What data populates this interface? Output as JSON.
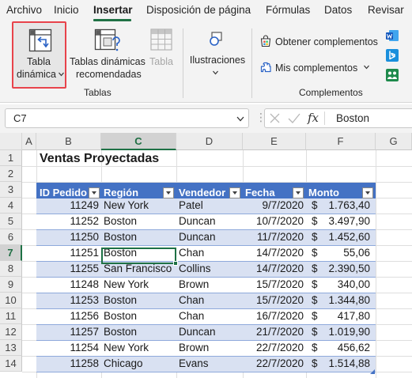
{
  "menu": {
    "tabs": [
      "Archivo",
      "Inicio",
      "Insertar",
      "Disposición de página",
      "Fórmulas",
      "Datos",
      "Revisar"
    ],
    "active": "Insertar"
  },
  "ribbon": {
    "tablas": {
      "pivot_line1": "Tabla",
      "pivot_line2": "dinámica",
      "recommended_line1": "Tablas dinámicas",
      "recommended_line2": "recomendadas",
      "table_label": "Tabla",
      "group_label": "Tablas"
    },
    "ilustraciones": {
      "label": "Ilustraciones"
    },
    "complementos": {
      "get_addins": "Obtener complementos",
      "my_addins": "Mis complementos",
      "group_label": "Complementos"
    }
  },
  "formula_bar": {
    "name_box": "C7",
    "fx_label": "fx",
    "formula": "Boston"
  },
  "grid": {
    "columns": [
      "A",
      "B",
      "C",
      "D",
      "E",
      "F",
      "G"
    ],
    "selected_column": "C",
    "rows": [
      "1",
      "2",
      "3",
      "4",
      "5",
      "6",
      "7",
      "8",
      "9",
      "10",
      "11",
      "12",
      "13",
      "14"
    ],
    "selected_row": "7"
  },
  "sheet": {
    "title": "Ventas Proyectadas",
    "headers": [
      "ID Pedido",
      "Región",
      "Vendedor",
      "Fecha",
      "Monto"
    ],
    "currency_symbol": "$",
    "rows": [
      {
        "id": "11249",
        "region": "New York",
        "seller": "Patel",
        "date": "9/7/2020",
        "amount": "1.763,40"
      },
      {
        "id": "11252",
        "region": "Boston",
        "seller": "Duncan",
        "date": "10/7/2020",
        "amount": "3.497,90"
      },
      {
        "id": "11250",
        "region": "Boston",
        "seller": "Duncan",
        "date": "11/7/2020",
        "amount": "1.452,60"
      },
      {
        "id": "11251",
        "region": "Boston",
        "seller": "Chan",
        "date": "14/7/2020",
        "amount": "55,06"
      },
      {
        "id": "11255",
        "region": "San Francisco",
        "seller": "Collins",
        "date": "14/7/2020",
        "amount": "2.390,50"
      },
      {
        "id": "11248",
        "region": "New York",
        "seller": "Brown",
        "date": "15/7/2020",
        "amount": "340,00"
      },
      {
        "id": "11253",
        "region": "Boston",
        "seller": "Chan",
        "date": "15/7/2020",
        "amount": "1.344,80"
      },
      {
        "id": "11256",
        "region": "Boston",
        "seller": "Chan",
        "date": "16/7/2020",
        "amount": "417,80"
      },
      {
        "id": "11257",
        "region": "Boston",
        "seller": "Duncan",
        "date": "21/7/2020",
        "amount": "1.019,90"
      },
      {
        "id": "11254",
        "region": "New York",
        "seller": "Brown",
        "date": "22/7/2020",
        "amount": "456,62"
      },
      {
        "id": "11258",
        "region": "Chicago",
        "seller": "Evans",
        "date": "22/7/2020",
        "amount": "1.514,88"
      }
    ]
  },
  "colors": {
    "accent_green": "#1e7145",
    "table_header": "#4472c4",
    "table_band": "#d9e1f2",
    "highlight_red": "#e8434b"
  },
  "icons": [
    "pivot-table-icon",
    "recommended-pivot-icon",
    "table-icon",
    "illustrations-icon",
    "store-icon",
    "my-addins-icon",
    "word-addin-icon",
    "bing-icon",
    "people-graph-icon",
    "chevron-down-icon",
    "cancel-icon",
    "enter-check-icon",
    "function-icon",
    "filter-dropdown-icon"
  ]
}
